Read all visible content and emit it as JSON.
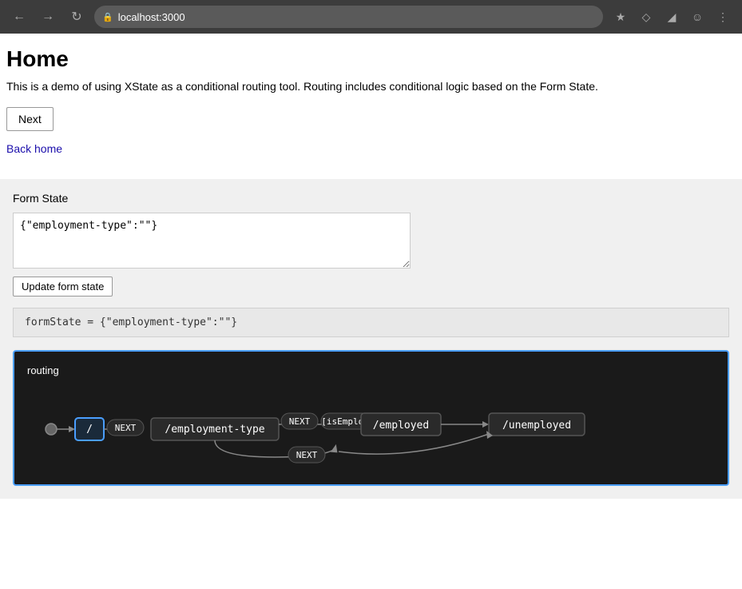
{
  "browser": {
    "url": "localhost:3000",
    "back_disabled": false,
    "forward_disabled": false
  },
  "page": {
    "title": "Home",
    "description": "This is a demo of using XState as a conditional routing tool. Routing includes conditional logic based on the Form State.",
    "next_button_label": "Next",
    "back_home_link_label": "Back home"
  },
  "form_state_section": {
    "label": "Form State",
    "textarea_value": "{\"employment-type\":\"\"}",
    "update_button_label": "Update form state",
    "state_display": "formState = {\"employment-type\":\"\"}"
  },
  "routing_diagram": {
    "title": "routing",
    "nodes": [
      {
        "id": "root",
        "label": "/"
      },
      {
        "id": "employment-type",
        "label": "/employment-type"
      },
      {
        "id": "employed",
        "label": "/employed"
      },
      {
        "id": "unemployed",
        "label": "/unemployed"
      }
    ],
    "transitions": [
      {
        "from": "/",
        "to": "/employment-type",
        "label": "NEXT"
      },
      {
        "from": "/employment-type",
        "to": "/employed",
        "label": "NEXT",
        "guard": "[isEmployed]"
      },
      {
        "from": "/employment-type",
        "to": "/unemployed",
        "label": "NEXT"
      }
    ]
  }
}
